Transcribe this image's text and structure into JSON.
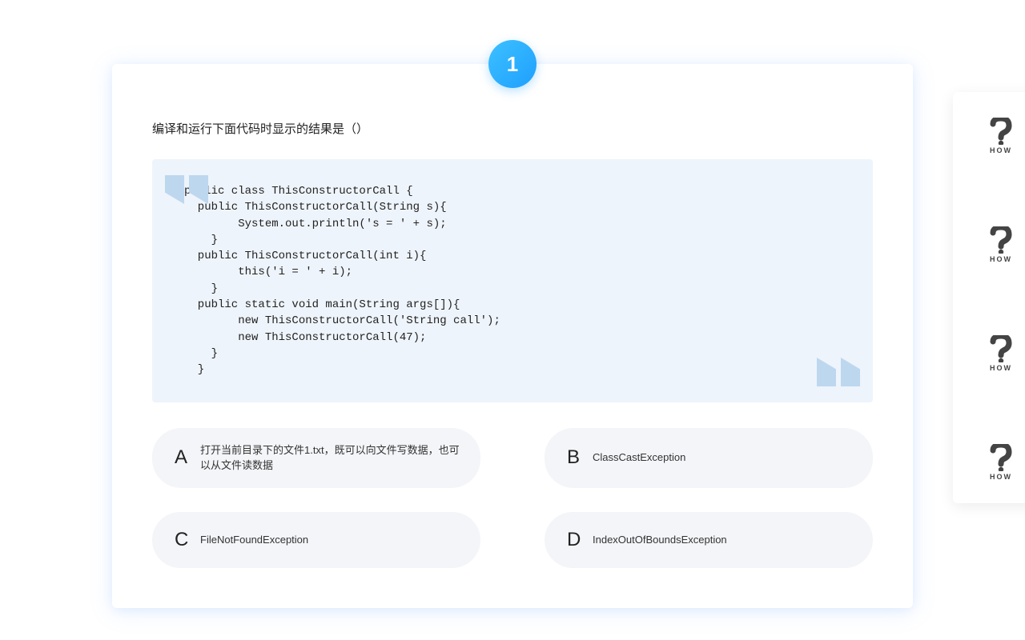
{
  "question_number": "1",
  "prompt": "编译和运行下面代码时显示的结果是（）",
  "code": "public class ThisConstructorCall {\n  public ThisConstructorCall(String s){\n        System.out.println('s = ' + s);\n    }\n  public ThisConstructorCall(int i){\n        this('i = ' + i);\n    }\n  public static void main(String args[]){\n        new ThisConstructorCall('String call');\n        new ThisConstructorCall(47);\n    }\n  }",
  "options": [
    {
      "letter": "A",
      "text": "打开当前目录下的文件1.txt，既可以向文件写数据，也可以从文件读数据"
    },
    {
      "letter": "B",
      "text": "ClassCastException"
    },
    {
      "letter": "C",
      "text": "FileNotFoundException"
    },
    {
      "letter": "D",
      "text": "IndexOutOfBoundsException"
    }
  ],
  "sidebar": {
    "icon_label": "HOW"
  }
}
